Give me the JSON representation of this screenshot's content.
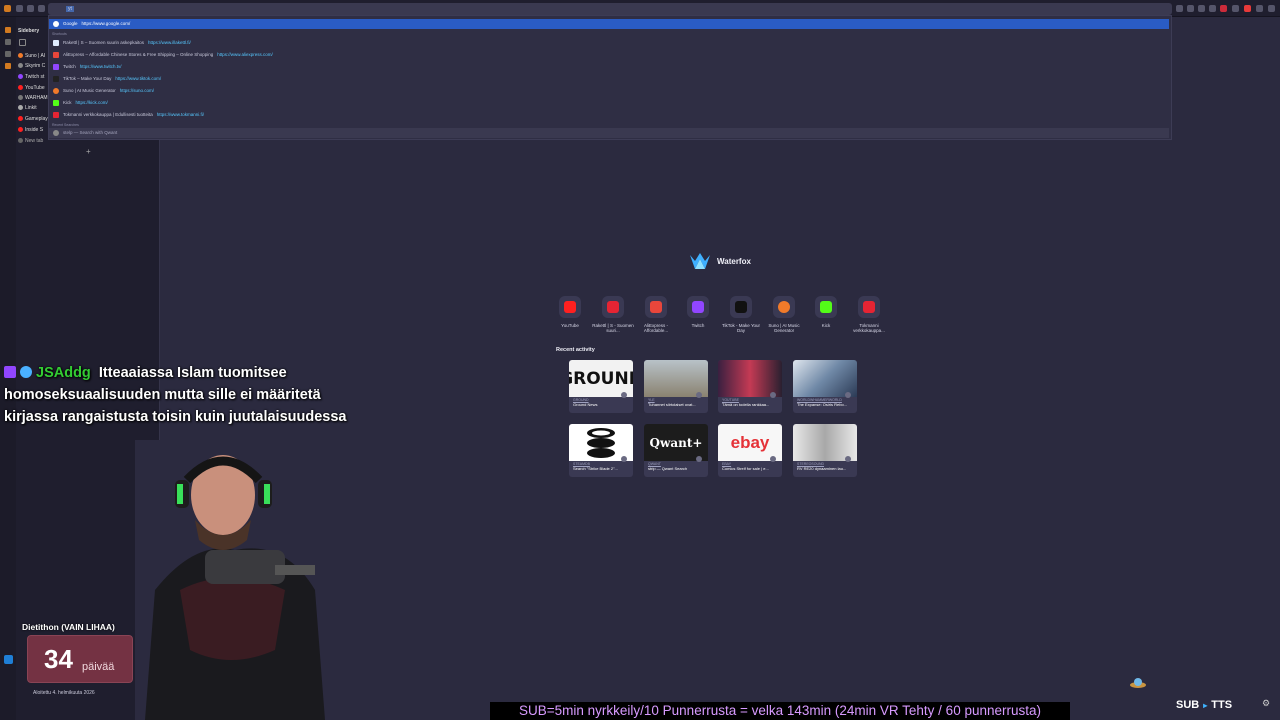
{
  "browser": {
    "url_text": "yt",
    "autocomplete": {
      "highlighted": {
        "title": "Google",
        "url": "https://www.google.com/"
      },
      "section_label": "Shortcuts",
      "rows": [
        {
          "title": "Rakettl | S – Suomen suurin askepkaitos",
          "url": "https://www.illakettl.fi/",
          "color": "#e0ecff"
        },
        {
          "title": "AliExpress – Affordable Chinese Stores & Free Shipping – Online Shopping",
          "url": "https://www.aliexpress.com/",
          "color": "#e8463b"
        },
        {
          "title": "Twitch",
          "url": "https://www.twitch.tv/",
          "color": "#9146ff"
        },
        {
          "title": "TikTok – Make Your Day",
          "url": "https://www.tiktok.com/",
          "color": "#222222"
        },
        {
          "title": "Suno | AI Music Generator",
          "url": "https://suno.com/",
          "color": "#f07a2a"
        },
        {
          "title": "Kick",
          "url": "https://kick.com/",
          "color": "#53fc18"
        },
        {
          "title": "Tokmanni verkkokauppa | Edullisesti tuotteita",
          "url": "https://www.tokmanni.fi/",
          "color": "#e52433"
        }
      ],
      "search_section_label": "Recent Searches",
      "search_row": "stelp  —  Search with Qwant"
    }
  },
  "sidebar": {
    "header": "Sidebery",
    "items": [
      {
        "label": "Suno | AI",
        "color": "#f07a2a"
      },
      {
        "label": "Skyrim C",
        "color": "#888888"
      },
      {
        "label": "Twitch st",
        "color": "#9146ff"
      },
      {
        "label": "YouTube",
        "color": "#ff2020"
      },
      {
        "label": "WARHAM",
        "color": "#777777"
      },
      {
        "label": "Linkit",
        "color": "#aaaaaa"
      },
      {
        "label": "Gameplay",
        "color": "#ff2020"
      },
      {
        "label": "Inside S",
        "color": "#ff2020"
      }
    ],
    "new_tab": "New tab"
  },
  "newtab": {
    "brand": "Waterfox",
    "shortcuts": [
      {
        "label": "YouTube",
        "color": "#ff2020"
      },
      {
        "label": "Rakettl | S - Suomen suuri...",
        "color": "#e52433"
      },
      {
        "label": "AliExpress - Affordable...",
        "color": "#e8463b"
      },
      {
        "label": "Twitch",
        "color": "#9146ff"
      },
      {
        "label": "TikTok - Make Your Day",
        "color": "#111111"
      },
      {
        "label": "Suno | AI Music Generator",
        "color": "#f07a2a"
      },
      {
        "label": "Kick",
        "color": "#53fc18"
      },
      {
        "label": "Tokmanni verkkokauppa...",
        "color": "#e52433"
      }
    ],
    "recent_title": "Recent activity",
    "recent": [
      {
        "source": "GROUND",
        "title": "Ground News",
        "thumb": "GROUND",
        "bg": "#f2f2f2",
        "fg": "#111111"
      },
      {
        "source": "YLE",
        "title": "Tuhannet siirtolaiset ovat...",
        "thumb": "",
        "bg": "#9a9890",
        "fg": "#ffffff"
      },
      {
        "source": "YOUTUBE",
        "title": "Tämä on todella rankkaa...",
        "thumb": "",
        "bg": "#c43a54",
        "fg": "#ffffff"
      },
      {
        "source": "WORLDWHAMMERWORLD",
        "title": "The Expanse: Osiris Rebo...",
        "thumb": "",
        "bg": "#6f88a6",
        "fg": "#ffffff"
      },
      {
        "source": "STEAMDB",
        "title": "Search \"Strike Blade 2\"...",
        "thumb": "",
        "bg": "#ffffff",
        "fg": "#111111"
      },
      {
        "source": "QWANT",
        "title": "strip — Qwant Search",
        "thumb": "Qwant+",
        "bg": "#1c1c1c",
        "fg": "#ffffff"
      },
      {
        "source": "EBAY",
        "title": "Comics Strelf for sale | e...",
        "thumb": "ebay",
        "bg": "#f7f7f7",
        "fg": "#e53238"
      },
      {
        "source": "STEREOSOUND",
        "title": "RV RE20 dynaaminen lau...",
        "thumb": "",
        "bg": "#d8d8d8",
        "fg": "#111111"
      }
    ]
  },
  "overlay": {
    "chat_user": "JSAddg",
    "chat_message": "Itteaaiassa Islam tuomitsee homoseksuaalisuuden mutta sille ei määritetä kirjassa rangaistusta toisin kuin juutalaisuudessa",
    "diet_title": "Dietithon (VAIN LIHAA)",
    "diet_days": "34",
    "diet_unit": "päivää",
    "diet_start": "Aloitettu 4. helmikuuta 2026",
    "ticker": "SUB=5min nyrkkeily/10 Punnerrusta = velka 143min (24min VR Tehty / 60 punnerrusta)",
    "sub_label": "SUB",
    "tts_label": "TTS"
  },
  "colors": {
    "page_bg": "#2b2a3f",
    "accent": "#2a5cc4",
    "link": "#56c8ff"
  }
}
